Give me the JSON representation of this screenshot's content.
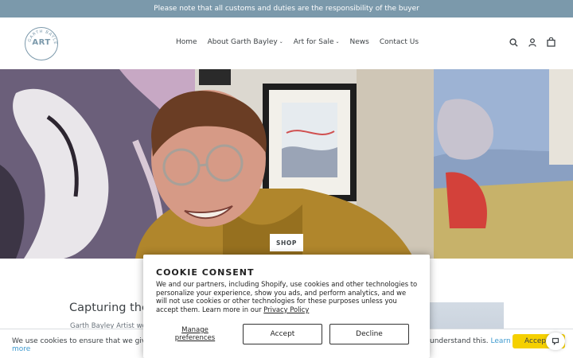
{
  "announcement": "Please note that all customs and duties are the responsibility of the buyer",
  "logo": {
    "arc_text": "GARTH BAYLEY",
    "text": "ART"
  },
  "nav": {
    "home": "Home",
    "about": "About Garth Bayley",
    "art_for_sale": "Art for Sale",
    "news": "News",
    "contact": "Contact Us"
  },
  "hero": {
    "button_label": "SHOP"
  },
  "section": {
    "title": "Capturing the",
    "body": "Garth Bayley Artist wor"
  },
  "cookie_bar": {
    "text": "We use cookies to ensure that we give",
    "text_right": "understand this.",
    "link": "Learn",
    "link_more": "more",
    "accept_label": "Accept"
  },
  "modal": {
    "title": "COOKIE CONSENT",
    "body": "We and our partners, including Shopify, use cookies and other technologies to personalize your experience, show you ads, and perform analytics, and we will not use cookies or other technologies for these purposes unless you accept them. Learn more in our",
    "privacy_link": "Privacy Policy",
    "manage_label": "Manage preferences",
    "accept_label": "Accept",
    "decline_label": "Decline"
  },
  "colors": {
    "brand": "#7b99ab",
    "accept_yellow": "#f5d000",
    "link": "#3e9acf"
  }
}
